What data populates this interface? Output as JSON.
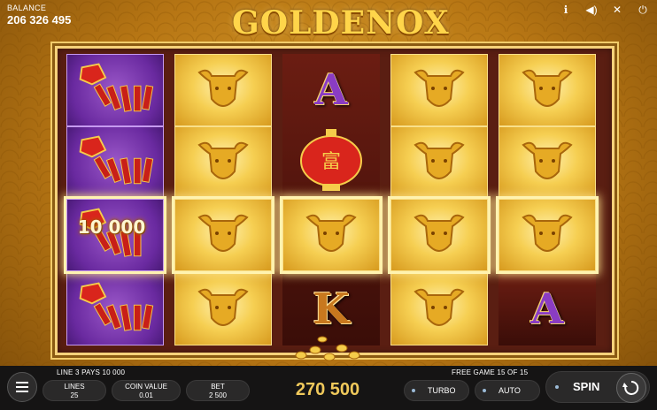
{
  "header": {
    "balance_label": "BALANCE",
    "balance_value": "206 326 495",
    "logo_text": "GOLDENOX",
    "icons": [
      "info-icon",
      "sound-icon",
      "fullscreen-icon",
      "power-icon"
    ]
  },
  "reels": {
    "columns": [
      [
        "firecracker",
        "firecracker",
        "firecracker",
        "firecracker"
      ],
      [
        "ox",
        "ox",
        "ox",
        "ox"
      ],
      [
        "A",
        "lantern",
        "ox",
        "K"
      ],
      [
        "ox",
        "ox",
        "ox",
        "ox"
      ],
      [
        "ox",
        "ox",
        "ox",
        "A"
      ]
    ],
    "win_amount": "10 000",
    "lantern_char": "富"
  },
  "footer": {
    "line_info": "LINE 3 PAYS 10 000",
    "free_game_info": "FREE GAME 15 OF 15",
    "lines_label": "LINES",
    "lines_value": "25",
    "coin_value_label": "COIN VALUE",
    "coin_value": "0.01",
    "bet_label": "BET",
    "bet_value": "2 500",
    "win_value": "270 500",
    "turbo_label": "TURBO",
    "auto_label": "AUTO",
    "spin_label": "SPIN"
  },
  "colors": {
    "gold": "#f0c95b",
    "bar": "#151414",
    "accent_dot": "#9bbad6",
    "firecracker_bg": "#6a2aa0"
  }
}
